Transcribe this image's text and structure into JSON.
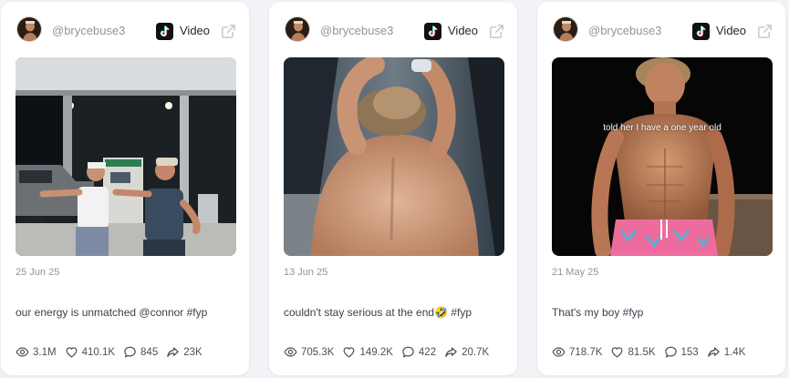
{
  "cards": [
    {
      "handle": "@brycebuse3",
      "platform": "Video",
      "platform_icon": "tiktok-icon",
      "external_icon": "external-link-icon",
      "date": "25 Jun 25",
      "caption": "our energy is unmatched @connor #fyp",
      "overlay_text": "",
      "stats": {
        "views": "3.1M",
        "likes": "410.1K",
        "comments": "845",
        "shares": "23K"
      }
    },
    {
      "handle": "@brycebuse3",
      "platform": "Video",
      "platform_icon": "tiktok-icon",
      "external_icon": "external-link-icon",
      "date": "13 Jun 25",
      "caption": "couldn't stay serious at the end🤣 #fyp",
      "overlay_text": "",
      "stats": {
        "views": "705.3K",
        "likes": "149.2K",
        "comments": "422",
        "shares": "20.7K"
      }
    },
    {
      "handle": "@brycebuse3",
      "platform": "Video",
      "platform_icon": "tiktok-icon",
      "external_icon": "external-link-icon",
      "date": "21 May 25",
      "caption": "That's my boy #fyp",
      "overlay_text": "told her I have a one year old",
      "stats": {
        "views": "718.7K",
        "likes": "81.5K",
        "comments": "153",
        "shares": "1.4K"
      }
    }
  ],
  "colors": {
    "background": "#f1f3f6",
    "card": "#ffffff",
    "muted_text": "#8f949c",
    "body_text": "#3b414b"
  },
  "stat_icons": [
    "eye-icon",
    "heart-icon",
    "comment-icon",
    "share-icon"
  ]
}
